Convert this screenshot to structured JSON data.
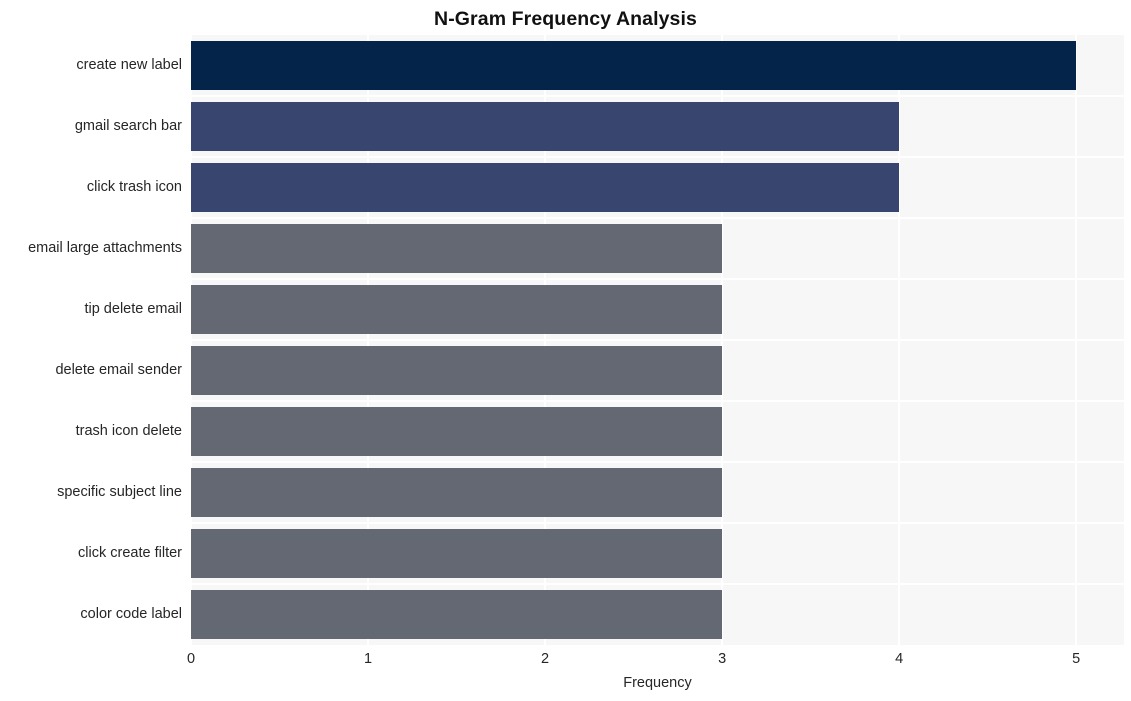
{
  "chart_data": {
    "type": "bar",
    "orientation": "horizontal",
    "title": "N-Gram Frequency Analysis",
    "xlabel": "Frequency",
    "ylabel": "",
    "categories": [
      "create new label",
      "gmail search bar",
      "click trash icon",
      "email large attachments",
      "tip delete email",
      "delete email sender",
      "trash icon delete",
      "specific subject line",
      "click create filter",
      "color code label"
    ],
    "values": [
      5,
      4,
      4,
      3,
      3,
      3,
      3,
      3,
      3,
      3
    ],
    "bar_colors": [
      "#042449",
      "#38456e",
      "#38456e",
      "#646872",
      "#646872",
      "#646872",
      "#646872",
      "#646872",
      "#646872",
      "#646872"
    ],
    "xlim": [
      0,
      5.27
    ],
    "xticks": [
      0,
      1,
      2,
      3,
      4,
      5
    ],
    "xtick_labels": [
      "0",
      "1",
      "2",
      "3",
      "4",
      "5"
    ],
    "grid": true,
    "legend": null,
    "plot_background": "#f7f7f8",
    "gridline_color": "#ffffff",
    "figure_background": "#ffffff",
    "text_color": "#262626"
  }
}
